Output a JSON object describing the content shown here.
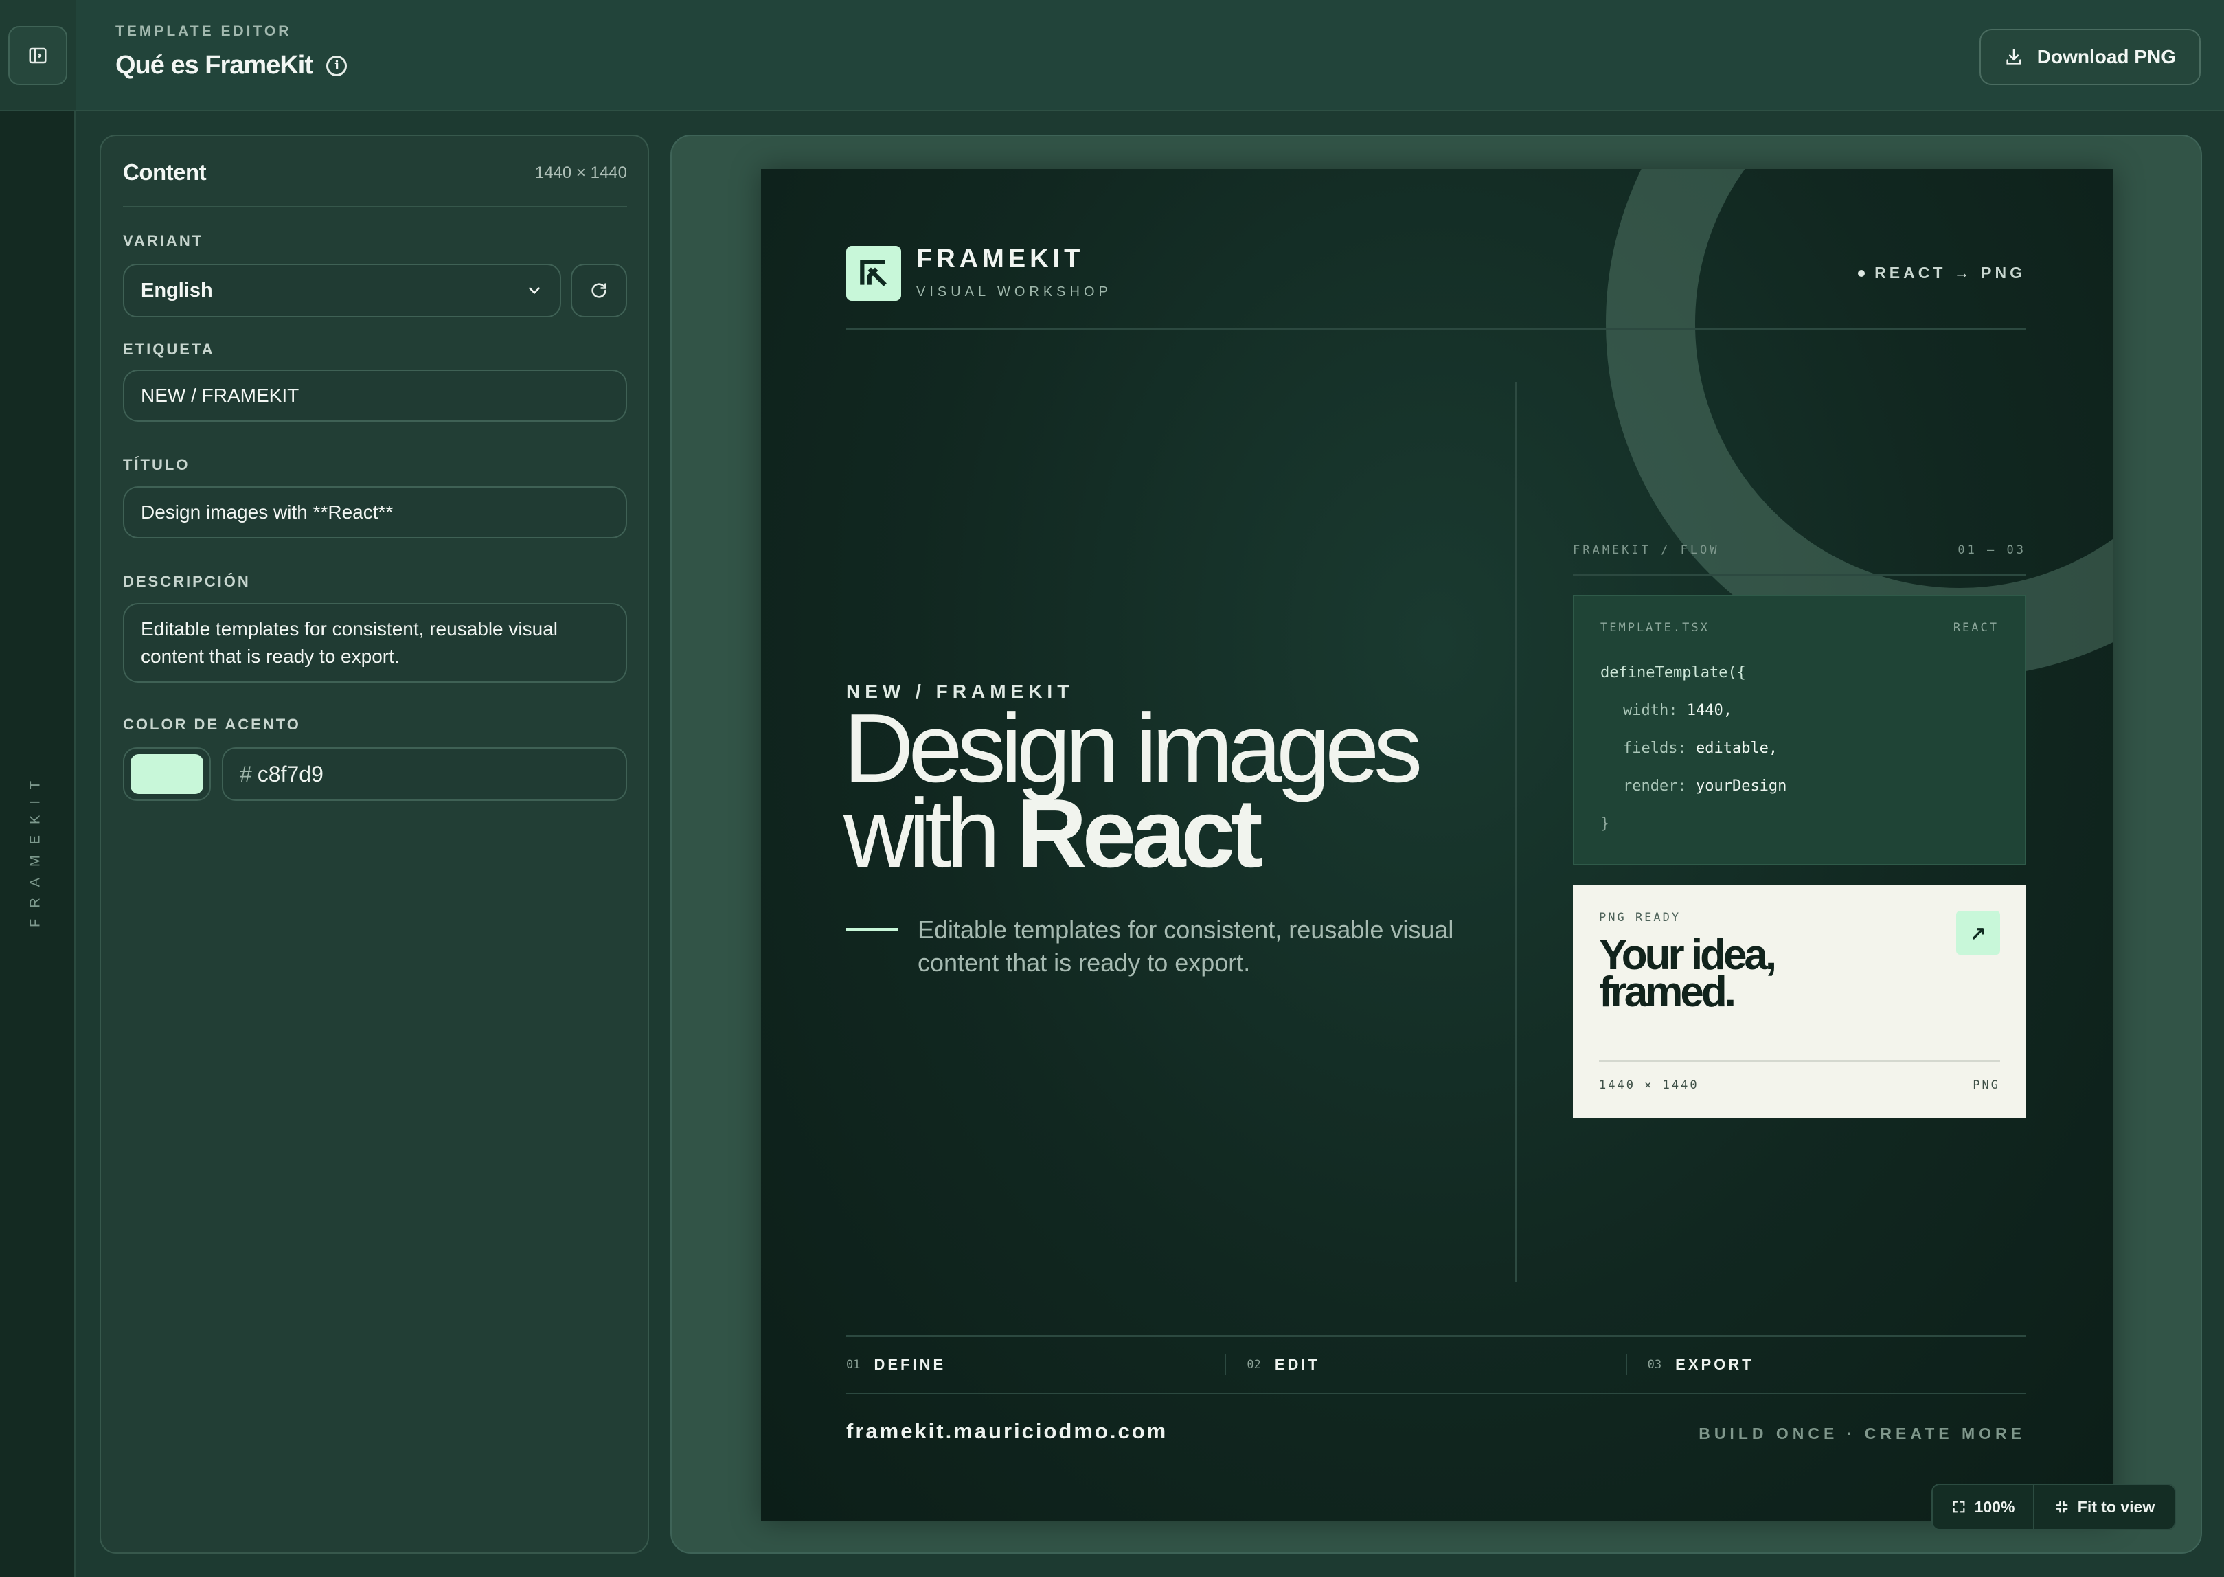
{
  "app": {
    "rail_label": "FRAMEKIT",
    "eyebrow": "TEMPLATE EDITOR",
    "title": "Qué es FrameKit",
    "download_label": "Download PNG"
  },
  "panel": {
    "title": "Content",
    "dimensions": "1440 × 1440",
    "variant": {
      "label": "VARIANT",
      "selected": "English"
    },
    "etiqueta": {
      "label": "ETIQUETA",
      "value": "NEW / FRAMEKIT"
    },
    "titulo": {
      "label": "TÍTULO",
      "value": "Design images with **React**"
    },
    "descripcion": {
      "label": "DESCRIPCIÓN",
      "value": "Editable templates for consistent, reusable visual content that is ready to export."
    },
    "accent": {
      "label": "COLOR DE ACENTO",
      "hash": "#",
      "value": "c8f7d9",
      "color": "#c8f7d9"
    }
  },
  "canvas": {
    "brand": "FRAMEKIT",
    "brand_sub": "VISUAL WORKSHOP",
    "tag": "REACT → PNG",
    "eyebrow": "NEW / FRAMEKIT",
    "headline_light": "Design images with",
    "headline_bold": "React",
    "description": "Editable templates for consistent, reusable visual content that is ready to export.",
    "flow": {
      "label": "FRAMEKIT / FLOW",
      "range": "01 — 03"
    },
    "code": {
      "file": "TEMPLATE.TSX",
      "lang": "REACT",
      "open": "defineTemplate({",
      "width_key": "width: ",
      "width_val": "1440,",
      "fields_key": "fields: ",
      "fields_val": "editable,",
      "render_key": "render: ",
      "render_val": "yourDesign",
      "close": "}"
    },
    "card": {
      "label": "PNG READY",
      "arrow": "↗",
      "headline_1": "Your idea,",
      "headline_2": "framed.",
      "size": "1440 × 1440",
      "format": "PNG"
    },
    "steps": [
      {
        "num": "01",
        "label": "DEFINE"
      },
      {
        "num": "02",
        "label": "EDIT"
      },
      {
        "num": "03",
        "label": "EXPORT"
      }
    ],
    "url": "framekit.mauriciodmo.com",
    "slogan": "BUILD ONCE · CREATE MORE"
  },
  "zoom": {
    "level": "100%",
    "fit_label": "Fit to view"
  },
  "colors": {
    "accent": "#c8f7d9",
    "background": "#1d3a31",
    "canvas": "#112720"
  }
}
